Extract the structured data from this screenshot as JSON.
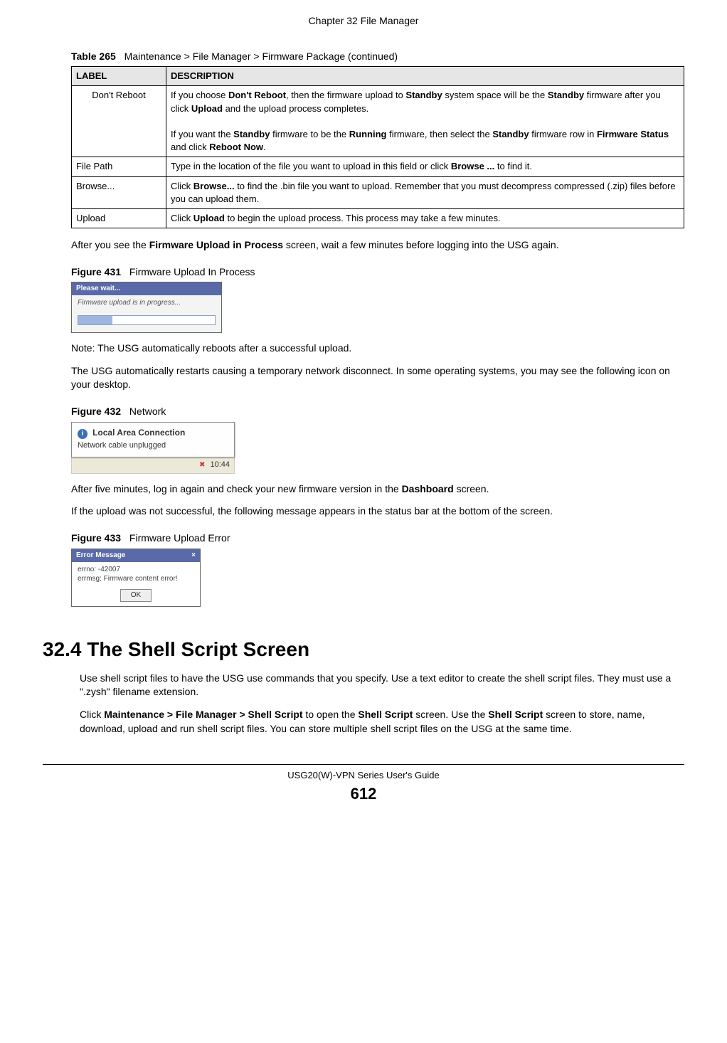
{
  "chapter_header": "Chapter 32 File Manager",
  "table": {
    "caption_num": "Table 265",
    "caption_text": "Maintenance > File Manager > Firmware Package (continued)",
    "header_label": "LABEL",
    "header_desc": "DESCRIPTION",
    "rows": [
      {
        "label": "Don't Reboot",
        "desc_p1_a": "If you choose ",
        "desc_p1_b": "Don't Reboot",
        "desc_p1_c": ", then the firmware upload to ",
        "desc_p1_d": "Standby",
        "desc_p1_e": " system space will be the ",
        "desc_p1_f": "Standby",
        "desc_p1_g": " firmware after you click ",
        "desc_p1_h": "Upload",
        "desc_p1_i": " and the upload process completes.",
        "desc_p2_a": "If you want the ",
        "desc_p2_b": "Standby",
        "desc_p2_c": " firmware to be the ",
        "desc_p2_d": "Running",
        "desc_p2_e": " firmware, then select the ",
        "desc_p2_f": "Standby",
        "desc_p2_g": " firmware row in ",
        "desc_p2_h": "Firmware Status",
        "desc_p2_i": " and click ",
        "desc_p2_j": "Reboot Now",
        "desc_p2_k": "."
      },
      {
        "label": "File Path",
        "desc_a": "Type in the location of the file you want to upload in this field or click ",
        "desc_b": "Browse ...",
        "desc_c": " to find it."
      },
      {
        "label": "Browse...",
        "desc_a": "Click ",
        "desc_b": "Browse...",
        "desc_c": " to find the .bin file you want to upload. Remember that you must decompress compressed (.zip) files before you can upload them."
      },
      {
        "label": "Upload",
        "desc_a": "Click ",
        "desc_b": "Upload",
        "desc_c": " to begin the upload process. This process may take a few minutes."
      }
    ]
  },
  "para1_a": "After you see the ",
  "para1_b": "Firmware Upload in Process",
  "para1_c": " screen, wait a few minutes before logging into the USG again.",
  "fig431_num": "Figure 431",
  "fig431_title": "Firmware Upload In Process",
  "fig431_titlebar": "Please wait...",
  "fig431_msg": "Firmware upload is in progress...",
  "note1": "Note: The USG automatically reboots after a successful upload.",
  "para2": "The USG automatically restarts causing a temporary network disconnect. In some operating systems, you may see the following icon on your desktop.",
  "fig432_num": "Figure 432",
  "fig432_title": "Network",
  "fig432_balloon_title": "Local Area Connection",
  "fig432_balloon_sub": "Network cable unplugged",
  "fig432_time": "10:44",
  "para3_a": "After five minutes, log in again and check your new firmware version in the ",
  "para3_b": "Dashboard",
  "para3_c": " screen.",
  "para4": "If the upload was not successful, the following message appears in the status bar at the bottom of the screen.",
  "fig433_num": "Figure 433",
  "fig433_title": "Firmware Upload Error",
  "fig433_titlebar": "Error Message",
  "fig433_line1": "errno: -42007",
  "fig433_line2": "errmsg: Firmware content error!",
  "fig433_ok": "OK",
  "section_heading": "32.4  The Shell Script Screen",
  "section_p1": "Use shell script files to have the USG use commands that you specify. Use a text editor to create the shell script files. They must use a \".zysh\" filename extension.",
  "section_p2_a": "Click ",
  "section_p2_b": "Maintenance > File Manager > Shell Script",
  "section_p2_c": " to open the ",
  "section_p2_d": "Shell Script",
  "section_p2_e": " screen. Use the ",
  "section_p2_f": "Shell Script",
  "section_p2_g": " screen to store, name, download, upload and run shell script files. You can store multiple shell script files on the USG at the same time.",
  "footer_guide": "USG20(W)-VPN Series User's Guide",
  "footer_page": "612"
}
